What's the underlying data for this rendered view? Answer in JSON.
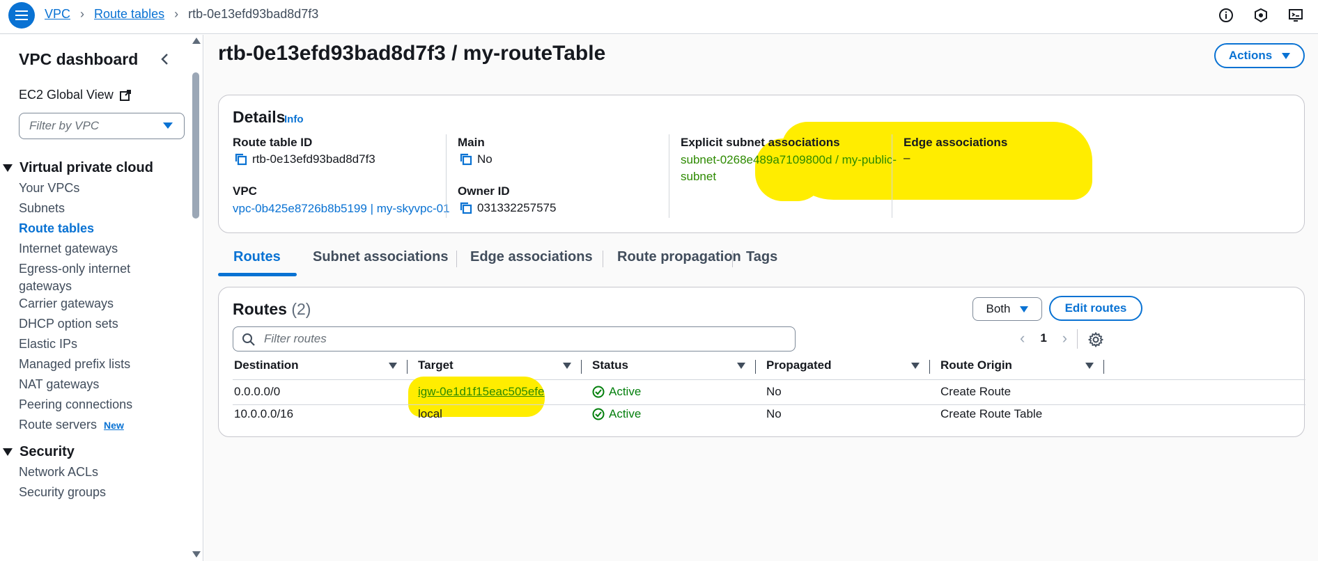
{
  "topbar": {
    "breadcrumbs": [
      "VPC",
      "Route tables"
    ],
    "current": "rtb-0e13efd93bad8d7f3",
    "icons": [
      "info-icon",
      "shield-icon",
      "cloudshell-icon"
    ]
  },
  "sidebar": {
    "title": "VPC dashboard",
    "ec2_global_view": "EC2 Global View",
    "filter_placeholder": "Filter by VPC",
    "section_vpc": "Virtual private cloud",
    "items": [
      "Your VPCs",
      "Subnets",
      "Route tables",
      "Internet gateways",
      "Egress-only internet gateways",
      "Carrier gateways",
      "DHCP option sets",
      "Elastic IPs",
      "Managed prefix lists",
      "NAT gateways",
      "Peering connections",
      "Route servers"
    ],
    "new_badge": "New",
    "section_security": "Security",
    "security_items": [
      "Network ACLs",
      "Security groups"
    ]
  },
  "page": {
    "title": "rtb-0e13efd93bad8d7f3 / my-routeTable",
    "actions_label": "Actions"
  },
  "details": {
    "title": "Details",
    "info": "Info",
    "route_table_id_label": "Route table ID",
    "route_table_id": "rtb-0e13efd93bad8d7f3",
    "main_label": "Main",
    "main": "No",
    "explicit_label": "Explicit subnet associations",
    "explicit_line1": "subnet-0268e489a7109800d / my-public-",
    "explicit_line2": "subnet",
    "edge_label": "Edge associations",
    "edge": "–",
    "vpc_label": "VPC",
    "vpc": "vpc-0b425e8726b8b5199 | my-skyvpc-01",
    "owner_label": "Owner ID",
    "owner": "031332257575"
  },
  "tabs": [
    "Routes",
    "Subnet associations",
    "Edge associations",
    "Route propagation",
    "Tags"
  ],
  "routes": {
    "title": "Routes",
    "count": "(2)",
    "both_label": "Both",
    "edit_label": "Edit routes",
    "filter_placeholder": "Filter routes",
    "page": "1",
    "columns": [
      "Destination",
      "Target",
      "Status",
      "Propagated",
      "Route Origin"
    ],
    "rows": [
      {
        "destination": "0.0.0.0/0",
        "target": "igw-0e1d1f15eac505efe",
        "status": "Active",
        "propagated": "No",
        "origin": "Create Route"
      },
      {
        "destination": "10.0.0.0/16",
        "target": "local",
        "status": "Active",
        "propagated": "No",
        "origin": "Create Route Table"
      }
    ]
  },
  "colors": {
    "accent": "#0972d3",
    "success": "#037f0c",
    "highlight": "#ffed00"
  }
}
